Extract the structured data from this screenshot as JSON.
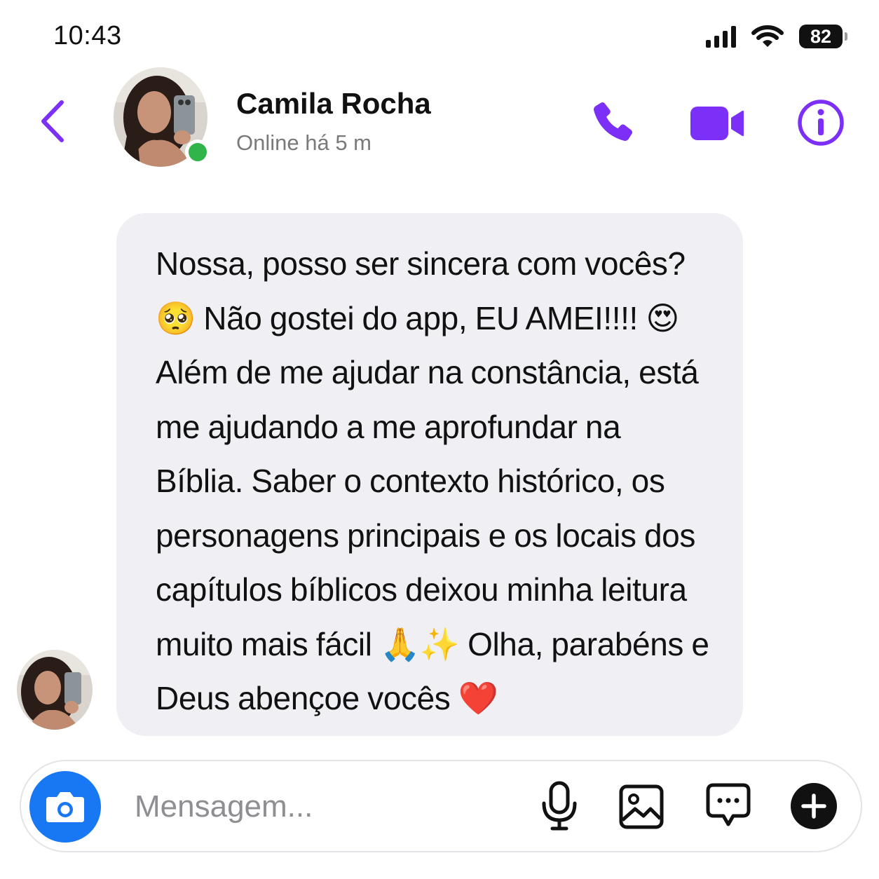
{
  "status_bar": {
    "time": "10:43",
    "battery": "82"
  },
  "header": {
    "contact_name": "Camila Rocha",
    "contact_status": "Online há 5 m",
    "online": true,
    "icons": [
      "back-icon",
      "phone-icon",
      "video-camera-icon",
      "info-icon"
    ],
    "accent_color": "#7b2ff7"
  },
  "message": {
    "text": "Nossa, posso ser sincera com vocês? 🥺 Não gostei do app, EU AMEI!!!! 😍 Além de me ajudar na constância, está me ajudando a me aprofundar na Bíblia. Saber o contexto histórico, os personagens principais e os locais dos capítulos bíblicos deixou minha leitura muito mais fácil 🙏✨ Olha, parabéns e Deus abençoe vocês ❤️"
  },
  "composer": {
    "placeholder": "Mensagem...",
    "icons": [
      "camera-icon",
      "microphone-icon",
      "image-icon",
      "chat-bubble-icon",
      "plus-icon"
    ],
    "camera_color": "#1877f2"
  }
}
